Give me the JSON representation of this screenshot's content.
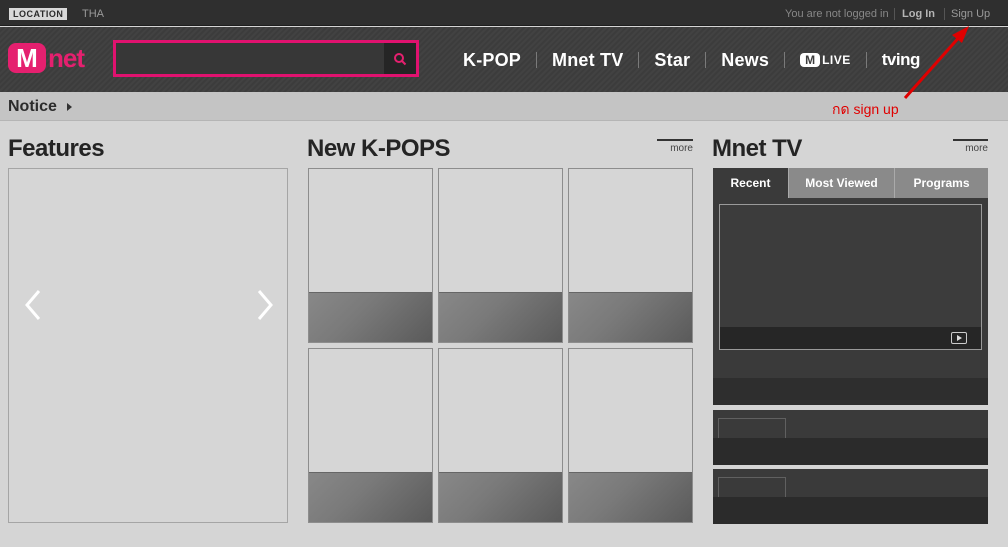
{
  "topbar": {
    "location_label": "LOCATION",
    "location_value": "THA",
    "login_status": "You are not logged in",
    "login_label": "Log In",
    "signup_label": "Sign Up"
  },
  "header": {
    "logo_m": "M",
    "logo_text": "net",
    "search_placeholder": "",
    "nav": [
      "K-POP",
      "Mnet TV",
      "Star",
      "News"
    ],
    "mlive_m": "M",
    "mlive_text": "LIVE",
    "tving": "tving"
  },
  "notice": {
    "label": "Notice"
  },
  "annotation": {
    "text": "กด sign up",
    "color": "#e00000"
  },
  "features": {
    "title": "Features"
  },
  "kpops": {
    "title": "New K-POPS",
    "more": "more"
  },
  "mnettv": {
    "title": "Mnet TV",
    "more": "more",
    "tabs": [
      "Recent",
      "Most Viewed",
      "Programs"
    ]
  },
  "colors": {
    "brand": "#e5206f",
    "search_border": "#e0126f",
    "header_bg": "#3c3c3c",
    "page_bg": "#d5d5d5"
  }
}
